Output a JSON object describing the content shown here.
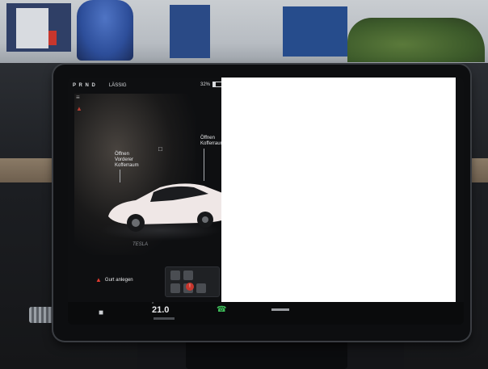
{
  "status_bar": {
    "gear": "P R N D",
    "profile": "LÄSSIG",
    "battery": "32%",
    "battery_fraction": 0.32
  },
  "callouts": {
    "front_trunk": [
      "Öffnen",
      "Vorderer",
      "Kofferraum"
    ],
    "rear_trunk": [
      "Öffnen",
      "Kofferraum"
    ]
  },
  "car_brand": "TESLA",
  "warning": {
    "label": "Gurt anlegen"
  },
  "dock": {
    "temperature": "21.0",
    "temp_caret": "^"
  },
  "icons": {
    "headlight": "headlight-icon",
    "seatbelt": "seatbelt-warning-icon",
    "lock": "lock-icon",
    "car": "car-icon",
    "phone": "phone-icon"
  },
  "colors": {
    "alert_red": "#e03b2f",
    "phone_green": "#3fbf5a",
    "screen_bg": "#0e0f11"
  }
}
